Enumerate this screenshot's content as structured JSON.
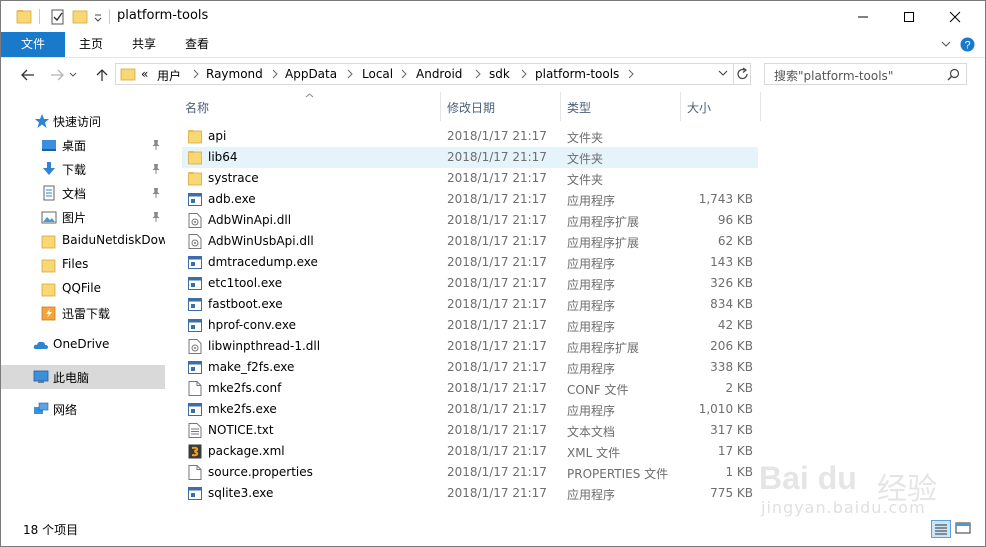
{
  "window": {
    "title": "platform-tools"
  },
  "ribbon": {
    "tabs": [
      "文件",
      "主页",
      "共享",
      "查看"
    ]
  },
  "address": {
    "overflow": "«",
    "crumbs": [
      "用户",
      "Raymond",
      "AppData",
      "Local",
      "Android",
      "sdk",
      "platform-tools"
    ]
  },
  "search": {
    "placeholder": "搜索\"platform-tools\""
  },
  "sidebar": {
    "items": [
      {
        "label": "快速访问",
        "icon": "star-icon"
      },
      {
        "label": "桌面",
        "icon": "desktop-icon",
        "pinned": true
      },
      {
        "label": "下载",
        "icon": "download-icon",
        "pinned": true
      },
      {
        "label": "文档",
        "icon": "document-icon",
        "pinned": true
      },
      {
        "label": "图片",
        "icon": "pictures-icon",
        "pinned": true
      },
      {
        "label": "BaiduNetdiskDow",
        "icon": "folder-icon"
      },
      {
        "label": "Files",
        "icon": "folder-icon"
      },
      {
        "label": "QQFile",
        "icon": "folder-icon"
      },
      {
        "label": "迅雷下载",
        "icon": "thunder-folder-icon"
      },
      {
        "label": "OneDrive",
        "icon": "cloud-icon"
      },
      {
        "label": "此电脑",
        "icon": "computer-icon",
        "selected": true
      },
      {
        "label": "网络",
        "icon": "network-icon"
      }
    ]
  },
  "columns": {
    "name": "名称",
    "date": "修改日期",
    "type": "类型",
    "size": "大小"
  },
  "files": [
    {
      "name": "api",
      "date": "2018/1/17 21:17",
      "type": "文件夹",
      "size": "",
      "icon": "folder"
    },
    {
      "name": "lib64",
      "date": "2018/1/17 21:17",
      "type": "文件夹",
      "size": "",
      "icon": "folder"
    },
    {
      "name": "systrace",
      "date": "2018/1/17 21:17",
      "type": "文件夹",
      "size": "",
      "icon": "folder"
    },
    {
      "name": "adb.exe",
      "date": "2018/1/17 21:17",
      "type": "应用程序",
      "size": "1,743 KB",
      "icon": "exe"
    },
    {
      "name": "AdbWinApi.dll",
      "date": "2018/1/17 21:17",
      "type": "应用程序扩展",
      "size": "96 KB",
      "icon": "dll"
    },
    {
      "name": "AdbWinUsbApi.dll",
      "date": "2018/1/17 21:17",
      "type": "应用程序扩展",
      "size": "62 KB",
      "icon": "dll"
    },
    {
      "name": "dmtracedump.exe",
      "date": "2018/1/17 21:17",
      "type": "应用程序",
      "size": "143 KB",
      "icon": "exe"
    },
    {
      "name": "etc1tool.exe",
      "date": "2018/1/17 21:17",
      "type": "应用程序",
      "size": "326 KB",
      "icon": "exe"
    },
    {
      "name": "fastboot.exe",
      "date": "2018/1/17 21:17",
      "type": "应用程序",
      "size": "834 KB",
      "icon": "exe"
    },
    {
      "name": "hprof-conv.exe",
      "date": "2018/1/17 21:17",
      "type": "应用程序",
      "size": "42 KB",
      "icon": "exe"
    },
    {
      "name": "libwinpthread-1.dll",
      "date": "2018/1/17 21:17",
      "type": "应用程序扩展",
      "size": "206 KB",
      "icon": "dll"
    },
    {
      "name": "make_f2fs.exe",
      "date": "2018/1/17 21:17",
      "type": "应用程序",
      "size": "338 KB",
      "icon": "exe"
    },
    {
      "name": "mke2fs.conf",
      "date": "2018/1/17 21:17",
      "type": "CONF 文件",
      "size": "2 KB",
      "icon": "file"
    },
    {
      "name": "mke2fs.exe",
      "date": "2018/1/17 21:17",
      "type": "应用程序",
      "size": "1,010 KB",
      "icon": "exe"
    },
    {
      "name": "NOTICE.txt",
      "date": "2018/1/17 21:17",
      "type": "文本文档",
      "size": "317 KB",
      "icon": "txt"
    },
    {
      "name": "package.xml",
      "date": "2018/1/17 21:17",
      "type": "XML 文件",
      "size": "17 KB",
      "icon": "xml"
    },
    {
      "name": "source.properties",
      "date": "2018/1/17 21:17",
      "type": "PROPERTIES 文件",
      "size": "1 KB",
      "icon": "file"
    },
    {
      "name": "sqlite3.exe",
      "date": "2018/1/17 21:17",
      "type": "应用程序",
      "size": "775 KB",
      "icon": "exe"
    }
  ],
  "status": {
    "count": "18 个项目"
  },
  "watermark": {
    "logo": "Bai du",
    "cn": "经验",
    "url": "jingyan.baidu.com"
  },
  "colors": {
    "accent": "#1979ca",
    "folder": "#f8d775",
    "hover": "#e5f3fb",
    "selected": "#d9d9d9"
  }
}
